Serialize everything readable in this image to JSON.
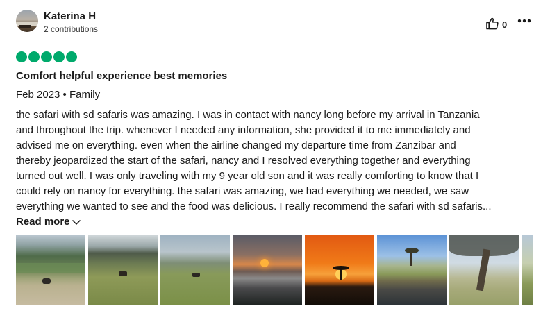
{
  "review": {
    "author": "Katerina H",
    "contributions": "2 contributions",
    "helpful_count": "0",
    "rating": 5,
    "title": "Comfort helpful experience best memories",
    "meta": "Feb 2023 • Family",
    "body_lines": [
      "the safari with sd safaris was amazing. I was in contact with nancy long before my arrival in Tanzania",
      "and throughout the trip. whenever I needed any information, she provided it to me immediately and",
      "advised me on everything. even when the airline changed my departure time from Zanzibar and",
      "thereby jeopardized the start of the safari, nancy and I resolved everything together and everything",
      "turned out well. I was only traveling with my 9 year old son and it was really comforting to know that I",
      "could rely on nancy for everything. the safari was amazing, we had everything we needed, we saw",
      "everything we wanted to see and the food was delicious. I really recommend the safari with sd safaris..."
    ],
    "read_more": "Read more"
  },
  "icons": {
    "helpful": "thumbs-up-icon",
    "more": "more-horizontal-icon",
    "read_more": "chevron-down-icon"
  },
  "colors": {
    "rating_bubble": "#00aa6c",
    "text": "#1a1a1a"
  },
  "photos": [
    {
      "name": "photo-elephant-crater"
    },
    {
      "name": "photo-buffalo-plains"
    },
    {
      "name": "photo-grassland-animal"
    },
    {
      "name": "photo-sunset-lake"
    },
    {
      "name": "photo-sunset-acacia"
    },
    {
      "name": "photo-river-hippos"
    },
    {
      "name": "photo-acacia-tree"
    },
    {
      "name": "photo-partial-next"
    }
  ]
}
